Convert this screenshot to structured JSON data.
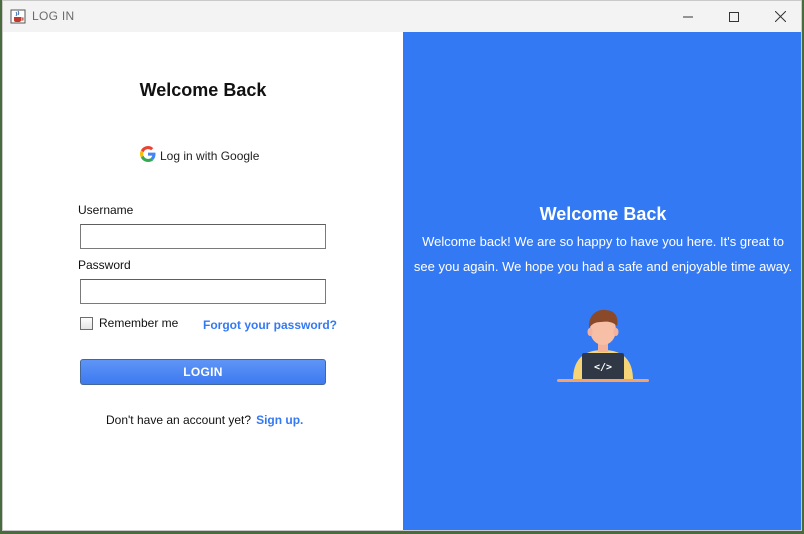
{
  "window": {
    "title": "LOG IN"
  },
  "login": {
    "heading": "Welcome Back",
    "google_label": "Log in with Google",
    "username_label": "Username",
    "username_value": "",
    "password_label": "Password",
    "password_value": "",
    "remember_label": "Remember me",
    "remember_checked": false,
    "forgot_label": "Forgot your password?",
    "login_button": "LOGIN",
    "signup_prompt": "Don't have an account yet?",
    "signup_link": "Sign up."
  },
  "welcome_panel": {
    "heading": "Welcome Back",
    "line1": "Welcome back! We are so happy to have you here. It's great to",
    "line2": "see you again. We hope you had a safe and enjoyable time away."
  },
  "colors": {
    "accent": "#3479f4",
    "panel_background": "#3479f4",
    "button": "#4b86f2"
  },
  "icons": {
    "app": "java-cup-icon",
    "google": "google-g-icon",
    "illustration": "developer-laptop-illustration"
  }
}
